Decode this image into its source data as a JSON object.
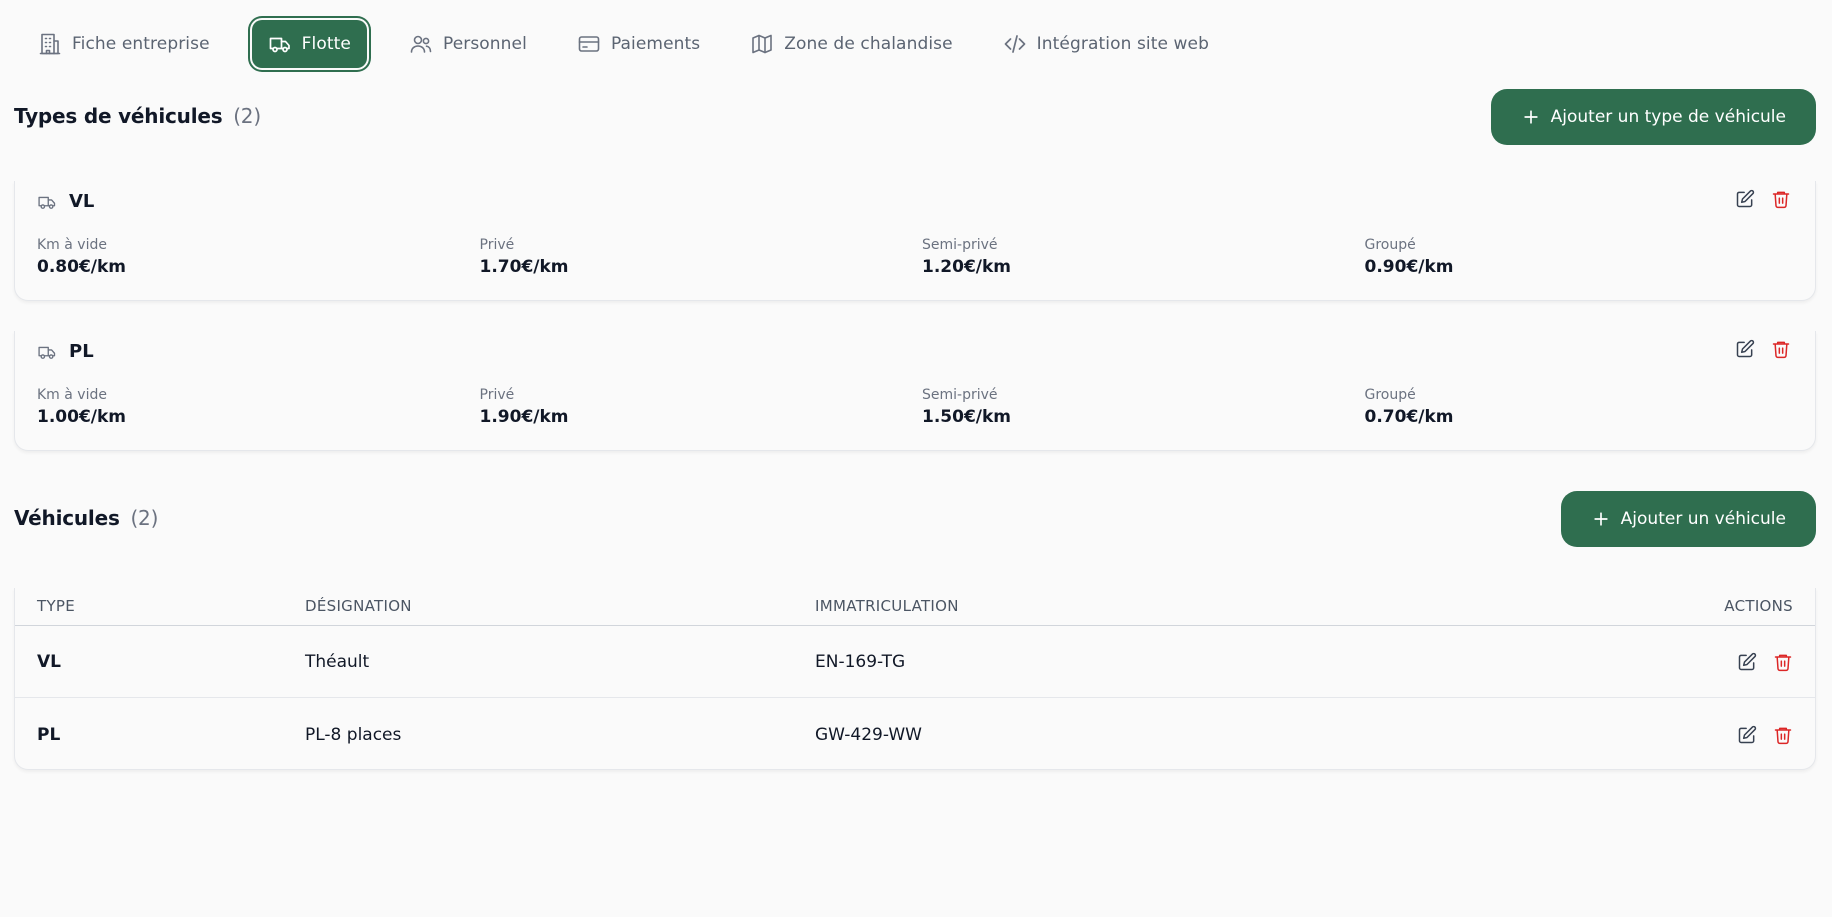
{
  "tabs": [
    {
      "label": "Fiche entreprise",
      "icon": "building-icon"
    },
    {
      "label": "Flotte",
      "icon": "truck-icon",
      "active": true
    },
    {
      "label": "Personnel",
      "icon": "users-icon"
    },
    {
      "label": "Paiements",
      "icon": "credit-card-icon"
    },
    {
      "label": "Zone de chalandise",
      "icon": "map-icon"
    },
    {
      "label": "Intégration site web",
      "icon": "code-icon"
    }
  ],
  "vehicle_types": {
    "title": "Types de véhicules",
    "count": "(2)",
    "add_label": "Ajouter un type de véhicule",
    "items": [
      {
        "name": "VL",
        "metrics": [
          {
            "label": "Km à vide",
            "value": "0.80€/km"
          },
          {
            "label": "Privé",
            "value": "1.70€/km"
          },
          {
            "label": "Semi-privé",
            "value": "1.20€/km"
          },
          {
            "label": "Groupé",
            "value": "0.90€/km"
          }
        ]
      },
      {
        "name": "PL",
        "metrics": [
          {
            "label": "Km à vide",
            "value": "1.00€/km"
          },
          {
            "label": "Privé",
            "value": "1.90€/km"
          },
          {
            "label": "Semi-privé",
            "value": "1.50€/km"
          },
          {
            "label": "Groupé",
            "value": "0.70€/km"
          }
        ]
      }
    ]
  },
  "vehicles": {
    "title": "Véhicules",
    "count": "(2)",
    "add_label": "Ajouter un véhicule",
    "columns": [
      "TYPE",
      "DÉSIGNATION",
      "IMMATRICULATION",
      "ACTIONS"
    ],
    "rows": [
      {
        "type": "VL",
        "designation": "Théault",
        "plate": "EN-169-TG"
      },
      {
        "type": "PL",
        "designation": "PL-8 places",
        "plate": "GW-429-WW"
      }
    ]
  },
  "colors": {
    "accent": "#2f6e4f",
    "danger": "#dc2626",
    "muted_text": "#6b7280",
    "background": "#fafafa"
  }
}
